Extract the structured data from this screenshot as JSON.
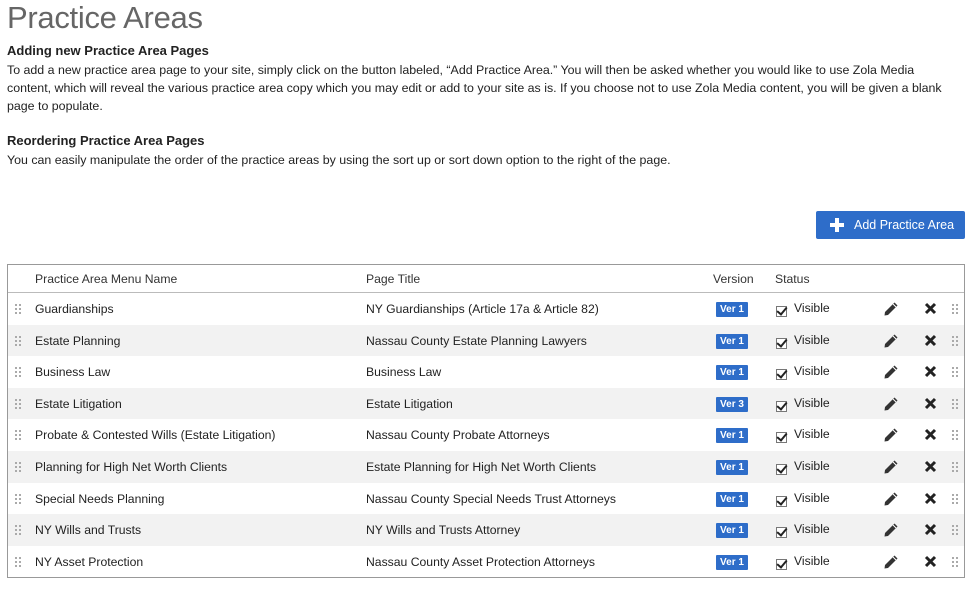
{
  "page": {
    "title": "Practice Areas"
  },
  "sections": [
    {
      "heading": "Adding new Practice Area Pages",
      "body": "To add a new practice area page to your site, simply click on the button labeled, “Add Practice Area.” You will then be asked whether you would like to use Zola Media content, which will reveal the various practice area copy which you may edit or add to your site as is. If you choose not to use Zola Media content, you will be given a blank page to populate."
    },
    {
      "heading": "Reordering Practice Area Pages",
      "body": "You can easily manipulate the order of the practice areas by using the sort up or sort down option to the right of the page."
    }
  ],
  "toolbar": {
    "add_label": "Add Practice Area"
  },
  "table": {
    "columns": [
      "Practice Area Menu Name",
      "Page Title",
      "Version",
      "Status"
    ],
    "rows": [
      {
        "name": "Guardianships",
        "page_title": "NY Guardianships (Article 17a & Article 82)",
        "version": "Ver 1",
        "status": "Visible",
        "checked": true
      },
      {
        "name": "Estate Planning",
        "page_title": "Nassau County Estate Planning Lawyers",
        "version": "Ver 1",
        "status": "Visible",
        "checked": true
      },
      {
        "name": "Business Law",
        "page_title": "Business Law",
        "version": "Ver 1",
        "status": "Visible",
        "checked": true
      },
      {
        "name": "Estate Litigation",
        "page_title": "Estate Litigation",
        "version": "Ver 3",
        "status": "Visible",
        "checked": true
      },
      {
        "name": "Probate & Contested Wills (Estate Litigation)",
        "page_title": "Nassau County Probate Attorneys",
        "version": "Ver 1",
        "status": "Visible",
        "checked": true
      },
      {
        "name": "Planning for High Net Worth Clients",
        "page_title": "Estate Planning for High Net Worth Clients",
        "version": "Ver 1",
        "status": "Visible",
        "checked": true
      },
      {
        "name": "Special Needs Planning",
        "page_title": "Nassau County Special Needs Trust Attorneys",
        "version": "Ver 1",
        "status": "Visible",
        "checked": true
      },
      {
        "name": "NY Wills and Trusts",
        "page_title": "NY Wills and Trusts Attorney",
        "version": "Ver 1",
        "status": "Visible",
        "checked": true
      },
      {
        "name": "NY Asset Protection",
        "page_title": "Nassau County Asset Protection Attorneys",
        "version": "Ver 1",
        "status": "Visible",
        "checked": true
      }
    ]
  },
  "colors": {
    "accent": "#2e6dc9",
    "row_alt": "#f2f2f2",
    "border": "#999999"
  },
  "icons": {
    "edit": "pencil-icon",
    "delete": "close-icon",
    "drag": "drag-handle-icon",
    "add": "plus-icon"
  }
}
